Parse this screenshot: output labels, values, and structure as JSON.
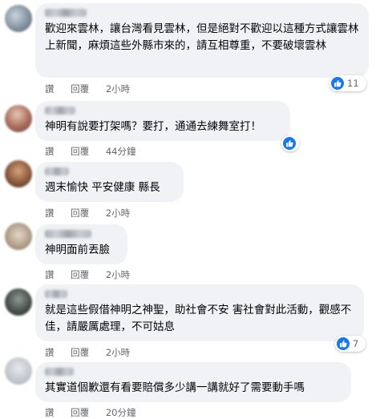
{
  "ui": {
    "like_label": "讚",
    "reply_label": "回覆"
  },
  "comments": [
    {
      "text": "歡迎來雲林，讓台灣看見雲林，但是絕對不歡迎以這種方式讓雲林上新聞，麻煩這些外縣市來的，請互相尊重，不要破壞雲林",
      "time": "2小時",
      "reactions": "11"
    },
    {
      "text": "神明有說要打架嗎？要打，通通去練舞室打！",
      "time": "44分鐘",
      "reactions": ""
    },
    {
      "text": "週末愉快 平安健康 縣長",
      "time": "2小時",
      "reactions": ""
    },
    {
      "text": "神明面前丟臉",
      "time": "2小時",
      "reactions": ""
    },
    {
      "text": "就是這些假借神明之神聖，助社會不安 害社會對此活動，觀感不佳，請嚴厲處理，不可姑息",
      "time": "2小時",
      "reactions": "7"
    },
    {
      "text": "其實道個歉還有看要賠償多少講一講就好了需要動手嗎",
      "time": "20分鐘",
      "reactions": ""
    }
  ],
  "colors": {
    "bubble": "#f0f2f5",
    "like_blue": "#1877f2",
    "meta_text": "#65676b"
  }
}
